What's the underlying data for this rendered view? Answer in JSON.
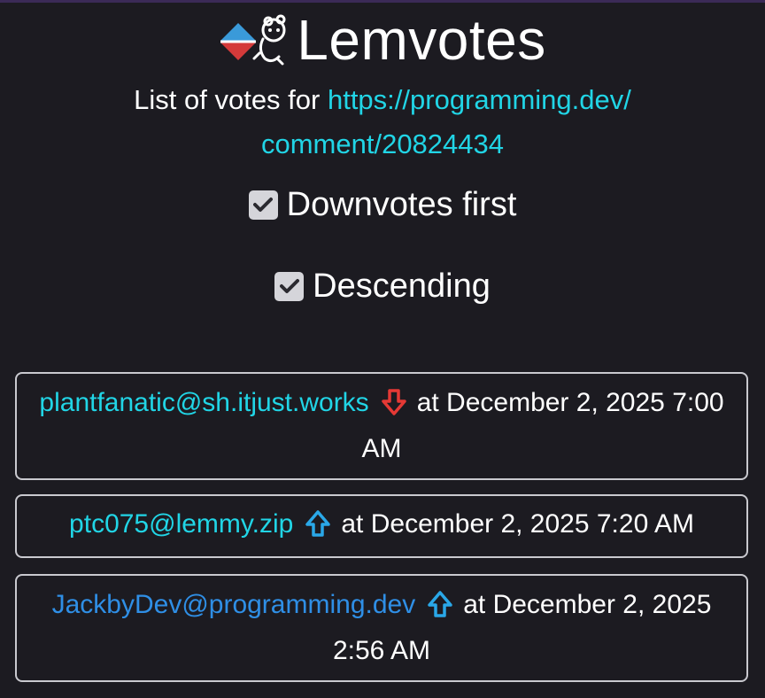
{
  "app": {
    "name": "Lemvotes"
  },
  "subtitle": {
    "prefix": "List of votes for ",
    "link_line1": "https://programming.dev/",
    "link_line2": "comment/20824434"
  },
  "options": [
    {
      "label": "Downvotes first",
      "checked": true
    },
    {
      "label": "Descending",
      "checked": true
    }
  ],
  "votes": [
    {
      "user": "plantfanatic@sh.itjust.works",
      "vote": "downvote",
      "icon": "down-arrow-icon",
      "at": "at December 2, 2025 7:00 AM"
    },
    {
      "user": "ptc075@lemmy.zip",
      "vote": "upvote",
      "icon": "up-arrow-icon",
      "at": "at December 2, 2025 7:20 AM"
    },
    {
      "user": "JackbyDev@programming.dev",
      "vote": "upvote",
      "icon": "up-arrow-icon",
      "at": "at December 2, 2025 2:56 AM"
    }
  ],
  "colors": {
    "background": "#1c1b21",
    "link_cyan": "#21d5e6",
    "link_blue": "#2f8fe6",
    "downvote_red": "#e53935",
    "upvote_blue": "#2aa8e8",
    "border": "#c9c9cf"
  }
}
